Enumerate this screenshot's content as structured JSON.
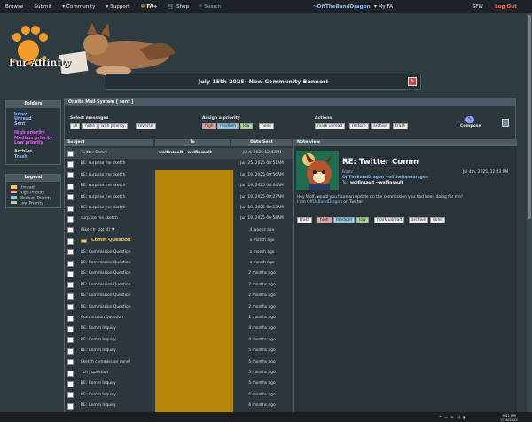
{
  "topnav": {
    "browse": "Browse",
    "submit": "Submit",
    "community": "Community",
    "support": "Support",
    "fa_plus": "FA+",
    "shop": "Shop",
    "search": "Search",
    "username": "~OffTheBandDragon",
    "my_fa": "My FA",
    "sfw": "SFW",
    "logout": "Log Out"
  },
  "logo_text": "Fur Affinity",
  "banner": "July 15th 2025- New Community Banner!",
  "folders": {
    "title": "Folders",
    "group1": [
      "Inbox",
      "Unread",
      "Sent"
    ],
    "group2": [
      "High priority",
      "Medium priority",
      "Low priority"
    ],
    "group3": [
      "Archive",
      "Trash"
    ]
  },
  "legend": {
    "title": "Legend",
    "items": [
      {
        "label": "Unread",
        "color": "#f4c85a"
      },
      {
        "label": "High Priority",
        "color": "#e8a3a3"
      },
      {
        "label": "Medium Priority",
        "color": "#8fc8e8"
      },
      {
        "label": "Low Priority",
        "color": "#a8d89a"
      }
    ]
  },
  "mail": {
    "header": "Onsite Mail System [ sent ]",
    "select_label": "Select messages",
    "select_buttons": [
      "all",
      "none",
      "with priority",
      "reverse"
    ],
    "priority_label": "Assign a priority",
    "priority_buttons": [
      "high",
      "medium",
      "low",
      "none"
    ],
    "actions_label": "Actions",
    "action_buttons": [
      "mark unread",
      "restore",
      "archive",
      "trash"
    ],
    "compose": "Compose",
    "col_subject": "Subject",
    "col_to": "To",
    "col_date": "Date Sent",
    "rows": [
      {
        "subject": "Twitter Comm",
        "to": "wolfinsault ~wolfinsault",
        "date": "Jul 4, 2025 12:43PM"
      },
      {
        "subject": "RE: surprise me sketch",
        "to": "",
        "date": "Jun 25, 2025 08:51AM"
      },
      {
        "subject": "RE: surprise me sketch",
        "to": "",
        "date": "Jun 19, 2025 09:56AM"
      },
      {
        "subject": "RE: surprise me sketch",
        "to": "",
        "date": "Jun 19, 2025 08:44AM"
      },
      {
        "subject": "RE: surprise me sketch",
        "to": "",
        "date": "Jun 19, 2025 08:27AM"
      },
      {
        "subject": "RE: surprise me sketch",
        "to": "",
        "date": "Jun 19, 2025 08:13AM"
      },
      {
        "subject": "surprise me sketch",
        "to": "",
        "date": "Jun 19, 2025 06:58AM"
      },
      {
        "subject": "[Sketch_slot_4] ♥",
        "to": "",
        "date": "4 weeks ago"
      },
      {
        "subject": "Comm Question",
        "to": "",
        "date": "a month ago"
      },
      {
        "subject": "RE: Commission Question",
        "to": "",
        "date": "a month ago"
      },
      {
        "subject": "RE: Commission Question",
        "to": "",
        "date": "a month ago"
      },
      {
        "subject": "RE: Commission Question",
        "to": "",
        "date": "2 months ago"
      },
      {
        "subject": "RE: Commission Question",
        "to": "",
        "date": "2 months ago"
      },
      {
        "subject": "RE: Commission Question",
        "to": "",
        "date": "2 months ago"
      },
      {
        "subject": "RE: Commission Question",
        "to": "",
        "date": "2 months ago"
      },
      {
        "subject": "Commission Question",
        "to": "",
        "date": "2 months ago"
      },
      {
        "subject": "RE: Comm Inquiry",
        "to": "",
        "date": "4 months ago"
      },
      {
        "subject": "RE: Comm Inquiry",
        "to": "",
        "date": "4 months ago"
      },
      {
        "subject": "RE: Comm Inquiry",
        "to": "",
        "date": "5 months ago"
      },
      {
        "subject": "Sketch commission done!",
        "to": "",
        "date": "5 months ago"
      },
      {
        "subject": "Ych | question",
        "to": "",
        "date": "5 months ago"
      },
      {
        "subject": "RE: Comm Inquiry",
        "to": "",
        "date": "5 months ago"
      },
      {
        "subject": "RE: Comm Inquiry",
        "to": "",
        "date": "6 months ago"
      },
      {
        "subject": "RE: Comm Inquiry",
        "to": "",
        "date": "6 months ago"
      }
    ]
  },
  "note": {
    "header": "Note view",
    "title": "RE: Twitter Comm",
    "from_label": "From:",
    "from_value": "OffTheBandDragon ~offthebanddragon",
    "to_label": "To:",
    "to_value": "wolfinsault ~wolfinsault",
    "date": "Jul 4th, 2025, 12:43 PM",
    "body": "Hey Wolf, would you have an update on the commission you had been doing for me?",
    "signature_prefix": "I am ",
    "signature_link": "OffDaBandDragon",
    "signature_suffix": " on Twitter",
    "buttons": [
      "trash",
      "high",
      "medium",
      "low",
      "mark unread",
      "archive",
      "none"
    ]
  },
  "taskbar": {
    "time": "9:41 PM",
    "date": "7/16/2025"
  }
}
